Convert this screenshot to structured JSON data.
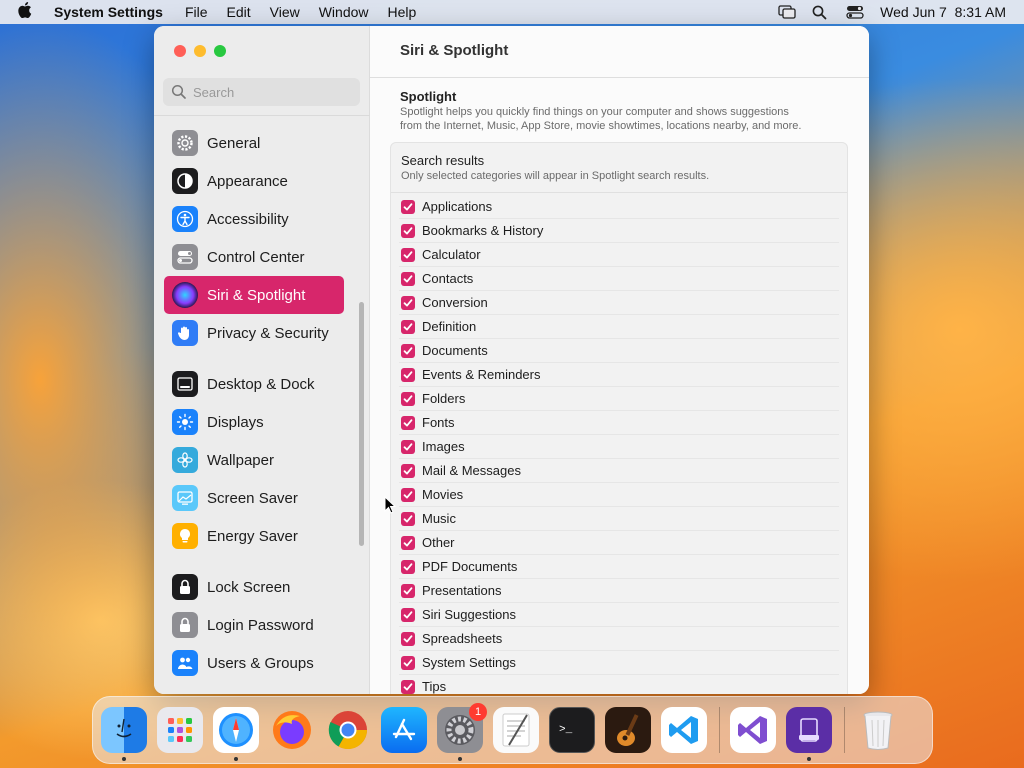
{
  "menubar": {
    "app_name": "System Settings",
    "menus": [
      "File",
      "Edit",
      "View",
      "Window",
      "Help"
    ],
    "datetime": "Wed Jun 7  8:31 AM"
  },
  "window": {
    "title": "Siri & Spotlight",
    "search_placeholder": "Search"
  },
  "sidebar": {
    "items": [
      {
        "label": "General",
        "icon": "gear-icon",
        "color": "#8e8e93"
      },
      {
        "label": "Appearance",
        "icon": "appearance-icon",
        "color": "#1c1c1e"
      },
      {
        "label": "Accessibility",
        "icon": "accessibility-icon",
        "color": "#1a82fb"
      },
      {
        "label": "Control Center",
        "icon": "control-center-icon",
        "color": "#8e8e93"
      },
      {
        "label": "Siri & Spotlight",
        "icon": "siri-icon",
        "color": "#3a2a6a",
        "active": true
      },
      {
        "label": "Privacy & Security",
        "icon": "hand-icon",
        "color": "#2f7cf6"
      },
      {
        "label": "Desktop & Dock",
        "icon": "desktop-dock-icon",
        "color": "#1c1c1e"
      },
      {
        "label": "Displays",
        "icon": "displays-icon",
        "color": "#1a82fb"
      },
      {
        "label": "Wallpaper",
        "icon": "wallpaper-icon",
        "color": "#35aadc"
      },
      {
        "label": "Screen Saver",
        "icon": "screen-saver-icon",
        "color": "#5ac8fa"
      },
      {
        "label": "Energy Saver",
        "icon": "energy-saver-icon",
        "color": "#ffb000"
      },
      {
        "label": "Lock Screen",
        "icon": "lock-icon",
        "color": "#1c1c1e"
      },
      {
        "label": "Login Password",
        "icon": "login-lock-icon",
        "color": "#8e8e93"
      },
      {
        "label": "Users & Groups",
        "icon": "users-icon",
        "color": "#1a82fb"
      }
    ]
  },
  "spotlight": {
    "title": "Spotlight",
    "description_line1": "Spotlight helps you quickly find things on your computer and shows suggestions",
    "description_line2": "from the Internet, Music, App Store, movie showtimes, locations nearby, and more."
  },
  "search_results": {
    "title": "Search results",
    "description": "Only selected categories will appear in Spotlight search results.",
    "categories": [
      "Applications",
      "Bookmarks & History",
      "Calculator",
      "Contacts",
      "Conversion",
      "Definition",
      "Documents",
      "Events & Reminders",
      "Folders",
      "Fonts",
      "Images",
      "Mail & Messages",
      "Movies",
      "Music",
      "Other",
      "PDF Documents",
      "Presentations",
      "Siri Suggestions",
      "Spreadsheets",
      "System Settings",
      "Tips"
    ]
  },
  "dock": {
    "apps": [
      {
        "name": "Finder",
        "icon": "finder-icon",
        "running": true
      },
      {
        "name": "Launchpad",
        "icon": "launchpad-icon"
      },
      {
        "name": "Safari",
        "icon": "safari-icon",
        "running": true
      },
      {
        "name": "Firefox",
        "icon": "firefox-icon"
      },
      {
        "name": "Chrome",
        "icon": "chrome-icon"
      },
      {
        "name": "App Store",
        "icon": "app-store-icon"
      },
      {
        "name": "System Settings",
        "icon": "system-settings-icon",
        "running": true,
        "badge": "1"
      },
      {
        "name": "TextEdit",
        "icon": "textedit-icon"
      },
      {
        "name": "Terminal",
        "icon": "terminal-icon"
      },
      {
        "name": "GarageBand",
        "icon": "garageband-icon"
      },
      {
        "name": "VS Code",
        "icon": "vscode-icon"
      },
      {
        "name": "Visual Studio",
        "icon": "visual-studio-icon"
      },
      {
        "name": "Simulator",
        "icon": "simulator-icon",
        "running": true
      },
      {
        "name": "Trash",
        "icon": "trash-icon"
      }
    ]
  },
  "colors": {
    "accent": "#d7266b"
  }
}
